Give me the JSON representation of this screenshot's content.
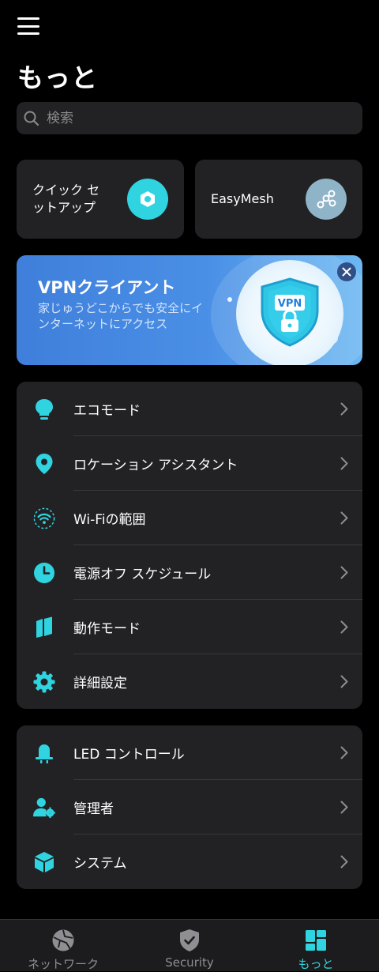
{
  "header": {
    "title": "もっと"
  },
  "search": {
    "placeholder": "検索"
  },
  "quick_actions": [
    {
      "label": "クイック セットアップ",
      "icon": "quick-setup-icon"
    },
    {
      "label": "EasyMesh",
      "icon": "mesh-icon"
    }
  ],
  "vpn_banner": {
    "title": "VPNクライアント",
    "description": "家じゅうどこからでも安全にインターネットにアクセス",
    "badge": "VPN"
  },
  "list1": [
    {
      "label": "エコモード",
      "icon": "lightbulb-icon"
    },
    {
      "label": "ロケーション アシスタント",
      "icon": "location-pin-icon"
    },
    {
      "label": "Wi-Fiの範囲",
      "icon": "wifi-range-icon"
    },
    {
      "label": "電源オフ スケジュール",
      "icon": "clock-icon"
    },
    {
      "label": "動作モード",
      "icon": "mode-icon"
    },
    {
      "label": "詳細設定",
      "icon": "gear-icon"
    }
  ],
  "list2": [
    {
      "label": "LED コントロール",
      "icon": "led-icon"
    },
    {
      "label": "管理者",
      "icon": "admin-icon"
    },
    {
      "label": "システム",
      "icon": "system-cube-icon"
    }
  ],
  "tabs": [
    {
      "label": "ネットワーク",
      "icon": "network-globe-icon",
      "active": false
    },
    {
      "label": "Security",
      "icon": "shield-check-icon",
      "active": false
    },
    {
      "label": "もっと",
      "icon": "more-grid-icon",
      "active": true
    }
  ],
  "colors": {
    "accent": "#2fd4e0",
    "card": "#222224",
    "background": "#000000",
    "banner": "#4a8fe6"
  }
}
